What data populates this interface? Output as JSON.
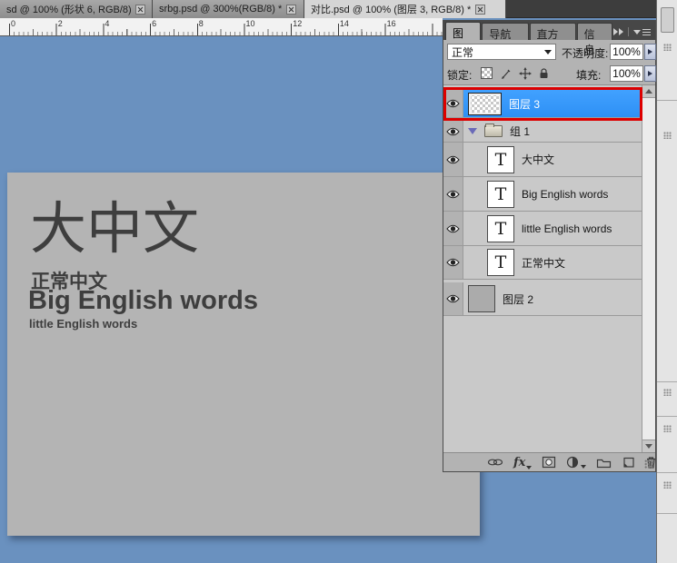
{
  "document_tabs": [
    {
      "label": "sd @ 100% (形状 6, RGB/8)"
    },
    {
      "label": "srbg.psd @ 300%(RGB/8) *"
    },
    {
      "label": "对比.psd @ 100% (图层 3, RGB/8) *"
    }
  ],
  "ruler": {
    "labels": [
      "0",
      "2",
      "4",
      "6",
      "8",
      "10",
      "12",
      "14",
      "16"
    ]
  },
  "canvas": {
    "big_chinese": "大中文",
    "normal_chinese": "正常中文",
    "big_english": "Big English words",
    "little_english": "little English words"
  },
  "panel": {
    "tabs": [
      {
        "label": "图层"
      },
      {
        "label": "导航器"
      },
      {
        "label": "直方图"
      },
      {
        "label": "信息"
      }
    ],
    "blend_mode_value": "正常",
    "opacity_label": "不透明度:",
    "opacity_value": "100%",
    "lock_label": "锁定:",
    "fill_label": "填充:",
    "fill_value": "100%",
    "fx_label": "fx",
    "text_layer_glyph": "T",
    "layers": [
      {
        "name": "图层 3",
        "type": "raster",
        "selected": true,
        "annotated": true
      },
      {
        "name": "组 1",
        "type": "group",
        "expanded": true
      },
      {
        "name": "大中文",
        "type": "text",
        "in_group": true
      },
      {
        "name": "Big English words",
        "type": "text",
        "in_group": true
      },
      {
        "name": "little English words",
        "type": "text",
        "in_group": true
      },
      {
        "name": "正常中文",
        "type": "text",
        "in_group": true
      },
      {
        "name": "图层 2",
        "type": "raster"
      }
    ]
  },
  "colors": {
    "selection_blue": "#3399ff",
    "annotation_red": "#dd0000",
    "workspace_blue": "#6a91bf",
    "canvas_gray": "#b4b4b4"
  }
}
